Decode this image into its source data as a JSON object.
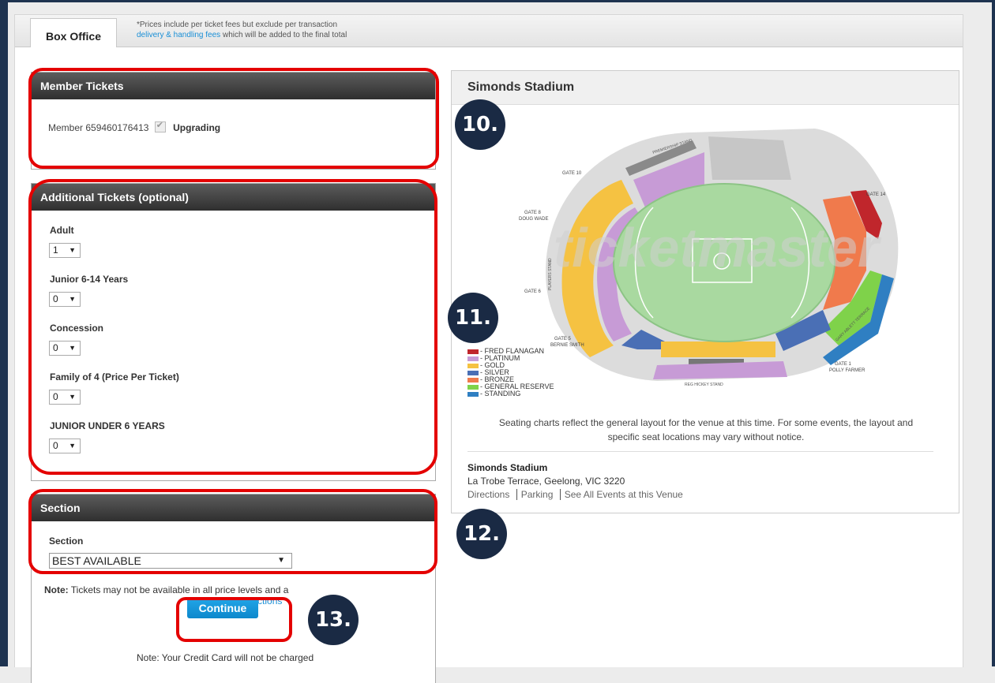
{
  "tab": {
    "label": "Box Office"
  },
  "fee_note": {
    "line1": "*Prices include per ticket fees but exclude per transaction",
    "link": "delivery & handling fees",
    "line2_rest": " which will be added to the final total"
  },
  "member_tickets": {
    "title": "Member Tickets",
    "member_text": "Member 659460176413",
    "status": "Upgrading",
    "checked": true
  },
  "additional_tickets": {
    "title": "Additional Tickets (optional)",
    "types": [
      {
        "label": "Adult",
        "qty": "1"
      },
      {
        "label": "Junior 6-14 Years",
        "qty": "0"
      },
      {
        "label": "Concession",
        "qty": "0"
      },
      {
        "label": "Family of 4 (Price Per Ticket)",
        "qty": "0"
      },
      {
        "label": "JUNIOR UNDER 6 YEARS",
        "qty": "0"
      }
    ]
  },
  "section": {
    "title": "Section",
    "label": "Section",
    "value": "BEST AVAILABLE",
    "note_bold": "Note:",
    "note_text": " Tickets may not be available in all price levels and a",
    "clear_link": "Clear All Selections",
    "continue_label": "Continue",
    "credit_note": "Note: Your Credit Card will not be charged"
  },
  "venue": {
    "title": "Simonds Stadium",
    "watermark": "ticketmaster",
    "map_labels": {
      "premiership_stand": "PREMIERSHIP STAND",
      "gate_10": "GATE 10",
      "gate_14": "GATE 14",
      "gate_8": "GATE 8",
      "doug_wade": "DOUG WADE",
      "players_stand": "PLAYERS STAND",
      "gate_6": "GATE 6",
      "gate_5": "GATE 5",
      "bernie_smith": "BERNIE SMITH",
      "gate_1": "GATE 1",
      "polly_farmer": "POLLY FARMER",
      "reg_hickey_stand": "REG HICKEY STAND",
      "gary_ablett_terrace": "GARY ABLETT TERRACE"
    },
    "legend": [
      {
        "label": "- FRED FLANAGAN",
        "color": "#c0262c"
      },
      {
        "label": "- PLATINUM",
        "color": "#c79bd6"
      },
      {
        "label": "- GOLD",
        "color": "#f5c242"
      },
      {
        "label": "- SILVER",
        "color": "#4a6fb5"
      },
      {
        "label": "- BRONZE",
        "color": "#f07a4c"
      },
      {
        "label": "- GENERAL RESERVE",
        "color": "#7fd24a"
      },
      {
        "label": "- STANDING",
        "color": "#2f7fc2"
      }
    ],
    "disclaimer_line1": "Seating charts reflect the general layout for the venue at this time. For some events, the layout and",
    "disclaimer_line2": "specific seat locations may vary without notice.",
    "name": "Simonds Stadium",
    "address": "La Trobe Terrace, Geelong, VIC 3220",
    "links": {
      "directions": "Directions",
      "parking": "Parking",
      "all_events": "See All Events at this Venue"
    }
  },
  "annotations": {
    "b10": "10.",
    "b11": "11.",
    "b12": "12.",
    "b13": "13."
  },
  "colors": {
    "annotation_ring": "#e40000",
    "badge_bg": "#1a2a44",
    "link": "#1a8fd6",
    "button": "#1a9ae0"
  }
}
